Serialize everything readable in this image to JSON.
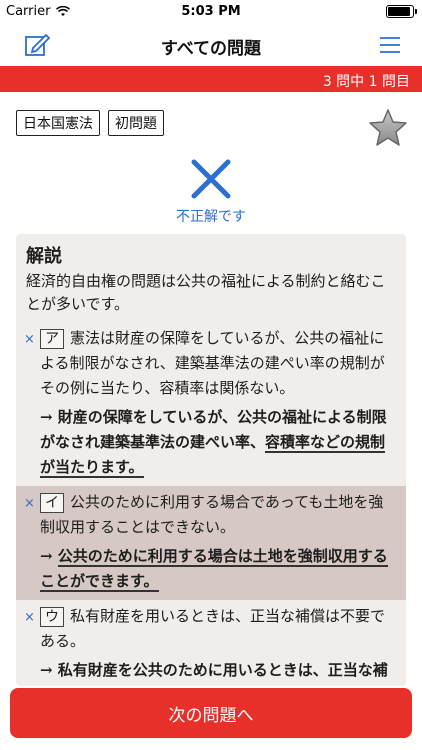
{
  "status": {
    "carrier": "Carrier",
    "time": "5:03 PM",
    "battery_level": 0.9
  },
  "nav": {
    "title": "すべての問題"
  },
  "progress": {
    "text": "3 問中 1 問目"
  },
  "tags": [
    "日本国憲法",
    "初問題"
  ],
  "result": {
    "text": "不正解です"
  },
  "explanation": {
    "heading": "解説",
    "intro": "経済的自由権の問題は公共の福祉による制約と絡むことが多いです。",
    "choices": [
      {
        "mark": "×",
        "label": "ア",
        "statement": "憲法は財産の保障をしているが、公共の福祉による制限がなされ、建築基準法の建ぺい率の規制がその例に当たり、容積率は関係ない。",
        "answer_plain": "→ 財産の保障をしているが、公共の福祉による制限がなされ建築基準法の建ぺい率、",
        "answer_underlined": "容積率などの規制が当たります。"
      },
      {
        "mark": "×",
        "label": "イ",
        "statement": "公共のために利用する場合であっても土地を強制収用することはできない。",
        "answer_plain": "→ ",
        "answer_underlined": "公共のために利用する場合は土地を強制収用することができます。"
      },
      {
        "mark": "×",
        "label": "ウ",
        "statement": "私有財産を用いるときは、正当な補償は不要である。",
        "answer_plain": "→ 私有財産を公共のために用いるときは、正当な補償が必要です。",
        "answer_underlined": ""
      }
    ]
  },
  "footer": {
    "next_label": "次の問題へ"
  },
  "colors": {
    "accent_red": "#e8302b",
    "accent_blue": "#2a6fd1"
  }
}
